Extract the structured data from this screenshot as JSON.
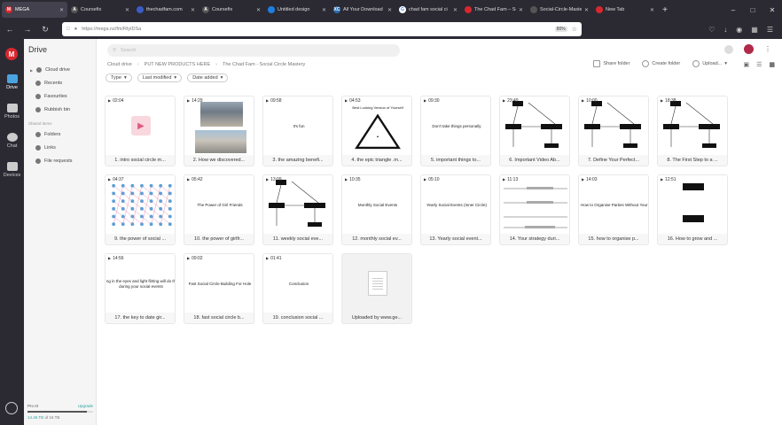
{
  "browser": {
    "tabs": [
      {
        "title": "MEGA",
        "favicon_color": "#d9272e",
        "favicon_letter": "M",
        "active": true
      },
      {
        "title": "Coursefix",
        "favicon_color": "#555555",
        "favicon_letter": "A",
        "active": false
      },
      {
        "title": "thechadfam.com",
        "favicon_color": "#3a5cc5",
        "favicon_letter": "",
        "active": false
      },
      {
        "title": "Coursefix",
        "favicon_color": "#555555",
        "favicon_letter": "A",
        "active": false
      },
      {
        "title": "Untitled design",
        "favicon_color": "#1e7fe0",
        "favicon_letter": "",
        "active": false
      },
      {
        "title": "All Your Download",
        "favicon_color": "#2b6cb0",
        "favicon_letter": "XC",
        "active": false
      },
      {
        "title": "chad fam social ci",
        "favicon_color": "#ffffff",
        "favicon_letter": "G",
        "active": false
      },
      {
        "title": "The Chad Fam – Sc",
        "favicon_color": "#d9272e",
        "favicon_letter": "",
        "active": false
      },
      {
        "title": "Social-Circle-Mastery",
        "favicon_color": "#555555",
        "favicon_letter": "",
        "active": false
      },
      {
        "title": "New Tab",
        "favicon_color": "#d9272e",
        "favicon_letter": "",
        "active": false
      }
    ],
    "url": "https://mega.nz/fm/RtylDSa",
    "zoom": "80%"
  },
  "rail": {
    "items": [
      {
        "label": "Drive",
        "active": true
      },
      {
        "label": "Photos",
        "active": false
      },
      {
        "label": "Chat",
        "active": false
      },
      {
        "label": "Devices",
        "active": false
      }
    ]
  },
  "sidebar": {
    "title": "Drive",
    "items": [
      {
        "label": "Cloud drive"
      },
      {
        "label": "Recents"
      },
      {
        "label": "Favourites"
      },
      {
        "label": "Rubbish bin"
      }
    ],
    "shared_heading": "Shared items",
    "shared_items": [
      {
        "label": "Folders"
      },
      {
        "label": "Links"
      },
      {
        "label": "File requests"
      }
    ],
    "plan": "Pro III",
    "upgrade": "Upgrade",
    "used": "14.46 TB",
    "total": "of 16 TB",
    "used_fraction": 0.9
  },
  "header": {
    "search_placeholder": "Search"
  },
  "breadcrumb": [
    "Cloud drive",
    "PUT NEW PRODUCTS HERE",
    "The Chad Fam - Social Circle Mastery"
  ],
  "actions": {
    "share": "Share folder",
    "create": "Create folder",
    "upload": "Upload..."
  },
  "filters": [
    "Type",
    "Last modified",
    "Date added"
  ],
  "files": [
    {
      "dur": "02:04",
      "name": "1. intro social circle m...",
      "thumb": "play",
      "thumb_text": ""
    },
    {
      "dur": "14:29",
      "name": "2. How we discovered...",
      "thumb": "photo",
      "thumb_text": ""
    },
    {
      "dur": "09:58",
      "name": "3. the amazing benefi...",
      "thumb": "text",
      "thumb_text": "It's fun"
    },
    {
      "dur": "04:53",
      "name": "4. the epic triangle .m...",
      "thumb": "triangle",
      "thumb_text": "Best Looking Version of Yourself"
    },
    {
      "dur": "09:30",
      "name": "5. important things to...",
      "thumb": "text",
      "thumb_text": "Don't take things personally"
    },
    {
      "dur": "23:49",
      "name": "6. Important Video Ab...",
      "thumb": "flow",
      "thumb_text": ""
    },
    {
      "dur": "10:00",
      "name": "7. Define Your Perfect...",
      "thumb": "flow",
      "thumb_text": ""
    },
    {
      "dur": "18:38",
      "name": "8. The First Step to a ...",
      "thumb": "flow",
      "thumb_text": ""
    },
    {
      "dur": "04:37",
      "name": "9. the power of social ...",
      "thumb": "network",
      "thumb_text": ""
    },
    {
      "dur": "05:42",
      "name": "10. the power of girlfr...",
      "thumb": "text",
      "thumb_text": "The Power of Girl Friends"
    },
    {
      "dur": "13:09",
      "name": "11. weekly social eve...",
      "thumb": "flow",
      "thumb_text": ""
    },
    {
      "dur": "10:35",
      "name": "12. monthly social ev...",
      "thumb": "text",
      "thumb_text": "Monthly Social Events"
    },
    {
      "dur": "05:10",
      "name": "13. Yearly social event...",
      "thumb": "text",
      "thumb_text": "Yearly Social Events (Inner Circle)"
    },
    {
      "dur": "11:13",
      "name": "14. Your strategy duri...",
      "thumb": "lines",
      "thumb_text": ""
    },
    {
      "dur": "14:03",
      "name": "15. how to organise p...",
      "thumb": "text",
      "thumb_text": "How to Organise Parties Without Your Cr"
    },
    {
      "dur": "12:51",
      "name": "16. How to grow and ...",
      "thumb": "boxes",
      "thumb_text": ""
    },
    {
      "dur": "14:56",
      "name": "17. the key to date gir...",
      "thumb": "text2",
      "thumb_text": "ng in the eyes and light flirting will do th",
      "thumb_text2": "during your social events"
    },
    {
      "dur": "09:02",
      "name": "18. fast social circle b...",
      "thumb": "text",
      "thumb_text": "Fast Social Circle Building For Hole"
    },
    {
      "dur": "01:41",
      "name": "19. conclusion social ...",
      "thumb": "text",
      "thumb_text": "Conclusion"
    },
    {
      "dur": "",
      "name": "Uploaded by www.ge...",
      "thumb": "doc",
      "thumb_text": ""
    }
  ]
}
